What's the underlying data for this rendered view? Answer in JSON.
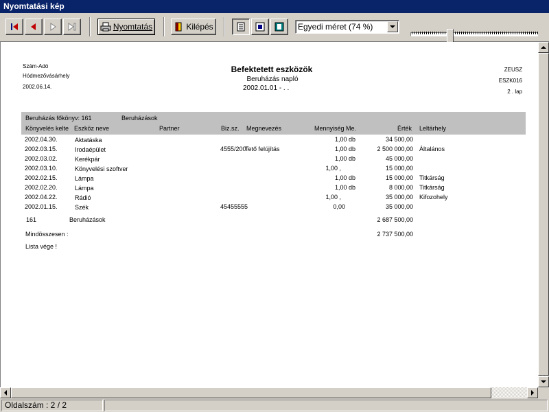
{
  "window": {
    "title": "Nyomtatási kép"
  },
  "toolbar": {
    "print_label": "Nyomtatás",
    "exit_label": "Kilépés",
    "zoom_value": "Egyedi méret (74 %)",
    "nav_icons": [
      "first-page-icon",
      "previous-page-icon",
      "next-page-icon",
      "last-page-icon"
    ],
    "zoom_slider_level": 0.3
  },
  "report": {
    "company": "Szám-Adó",
    "city": "Hódmezővásárhely",
    "date": "2002.06.14.",
    "title": "Befektetett eszközök",
    "subtitle": "Beruházás napló",
    "period": "2002.01.01 -     .   .",
    "user": "ZEUSZ",
    "code": "ESZK016",
    "page": "2 . lap",
    "group_line": {
      "label": "Beruházás főkönyv: 161",
      "name": "Beruházások"
    },
    "columns": [
      "Könyvelés kelte",
      "Eszköz neve",
      "Partner",
      "Biz.sz.",
      "Megnevezés",
      "Mennyiség Me.",
      "Érték",
      "Leltárhely"
    ],
    "rows": [
      {
        "date": "2002.04.30.",
        "asset": "Aktatáska",
        "partner": "",
        "doc": "",
        "desc": "",
        "qty": "1,00 db",
        "value": "34 500,00",
        "loc": ""
      },
      {
        "date": "2002.03.15.",
        "asset": "Irodaépület",
        "partner": "",
        "doc": "4555/200",
        "desc": "Tető felújítás",
        "qty": "1,00 db",
        "value": "2 500 000,00",
        "loc": "Általános"
      },
      {
        "date": "2002.03.02.",
        "asset": "Kerékpár",
        "partner": "",
        "doc": "",
        "desc": "",
        "qty": "1,00 db",
        "value": "45 000,00",
        "loc": ""
      },
      {
        "date": "2002.03.10.",
        "asset": "Könyvelési szoftver",
        "partner": "",
        "doc": "",
        "desc": "",
        "qty": "1,00 ,",
        "value": "15 000,00",
        "loc": ""
      },
      {
        "date": "2002.02.15.",
        "asset": "Lámpa",
        "partner": "",
        "doc": "",
        "desc": "",
        "qty": "1,00 db",
        "value": "15 000,00",
        "loc": "Titkárság"
      },
      {
        "date": "2002.02.20.",
        "asset": "Lámpa",
        "partner": "",
        "doc": "",
        "desc": "",
        "qty": "1,00 db",
        "value": "8 000,00",
        "loc": "Titkárság"
      },
      {
        "date": "2002.04.22.",
        "asset": "Rádió",
        "partner": "",
        "doc": "",
        "desc": "",
        "qty": "1,00 ,",
        "value": "35 000,00",
        "loc": "Kifozohely"
      },
      {
        "date": "2002.01.15.",
        "asset": "Szék",
        "partner": "",
        "doc": "45455555",
        "desc": "",
        "qty": "0,00",
        "value": "35 000,00",
        "loc": ""
      }
    ],
    "subtotal": {
      "code": "161",
      "name": "Beruházások",
      "value": "2 687 500,00"
    },
    "total": {
      "label": "Mindösszesen :",
      "value": "2 737 500,00"
    },
    "end": "Lista vége !"
  },
  "status": {
    "page_label": "Oldalszám : 2 / 2"
  }
}
